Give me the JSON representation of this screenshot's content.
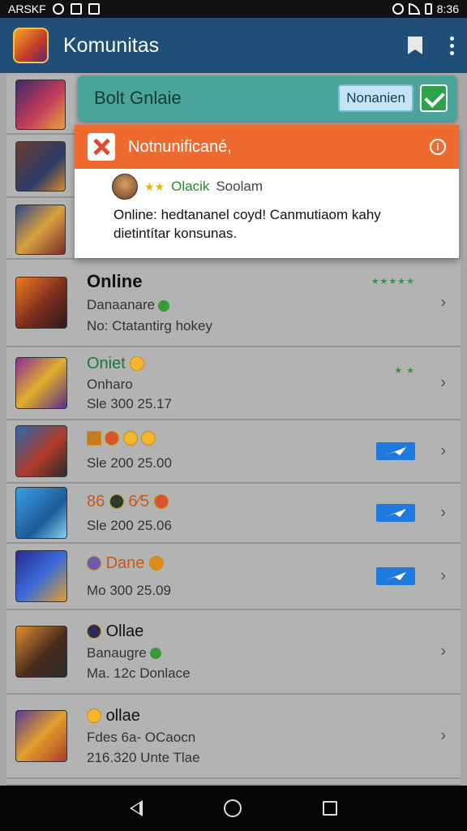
{
  "status": {
    "left_text": "ARSKF",
    "time": "8:36"
  },
  "app": {
    "title": "Komunitas"
  },
  "toast": {
    "text": "Bolt Gnlaie",
    "button_label": "Nonanien"
  },
  "notification": {
    "title": "Notnunificané,",
    "user_name": "Olacik",
    "user_sub": "Soolam",
    "body": "Online: hedtananel coyd! Canmutiaom kahy dietintítar konsunas."
  },
  "rows": [
    {
      "name": "Online",
      "line1": "Danaanare",
      "line2": "No: Ctatantirg hokey",
      "stars": "★★★★★"
    },
    {
      "name": "Oniet",
      "line1": "Onharo",
      "line2": "Sle 300 25.17",
      "stars": "★ ★"
    },
    {
      "line2": "Sle 200 25.00"
    },
    {
      "name": "86 ",
      "name2": "6⁄5",
      "line2": "Sle 200 25.06"
    },
    {
      "name": "Dane",
      "line2": "Mo 300 25.09"
    },
    {
      "name": "Ollae",
      "line1": "Banaugre",
      "line2": "Ma. 12c Donlace"
    },
    {
      "name": "ollae",
      "line1": "Fdes 6a- OCaocn",
      "line2": "216.320 Unte Tlae"
    }
  ],
  "colors": {
    "appbar": "#1f4e78",
    "toast": "#4aa49a",
    "notif_head": "#ee6a2e",
    "accent_blue": "#1f7ae0"
  }
}
